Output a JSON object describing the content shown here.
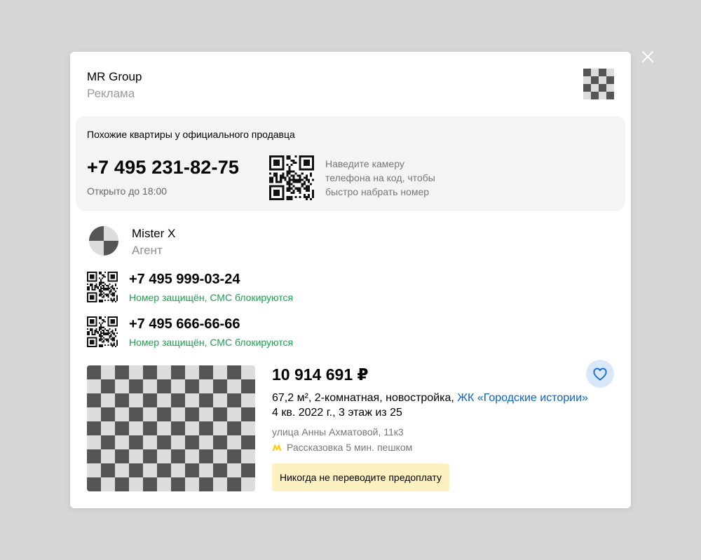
{
  "close_icon": "close-icon",
  "company": {
    "name": "MR Group",
    "subtitle": "Реклама",
    "logo_icon": "company-logo"
  },
  "official": {
    "title": "Похожие квартиры у официального продавца",
    "phone": "+7 495 231-82-75",
    "hours": "Открыто до 18:00",
    "qr_hint": "Наведите камеру телефона на код, чтобы быстро набрать номер"
  },
  "agent": {
    "name": "Mister X",
    "role": "Агент",
    "phones": [
      {
        "number": "+7 495 999-03-24",
        "note": "Номер защищён, СМС блокируются"
      },
      {
        "number": "+7 495 666-66-66",
        "note": "Номер защищён, СМС блокируются"
      }
    ]
  },
  "listing": {
    "price": "10 914 691 ₽",
    "description": "67,2 м², 2-комнатная, новостройка,",
    "complex_link": "ЖК «Городские истории»",
    "completion": "4 кв. 2022 г., 3 этаж из 25",
    "address": "улица Анны Ахматовой, 11к3",
    "metro": "Рассказовка 5 мин. пешком",
    "warning": "Никогда не переводите предоплату"
  },
  "colors": {
    "protected_note": "#1aa04b",
    "link": "#0b63c9",
    "metro": "#ffcc00",
    "favorite_bg": "#d9e8f7",
    "warning_bg": "#fdf0c1"
  }
}
